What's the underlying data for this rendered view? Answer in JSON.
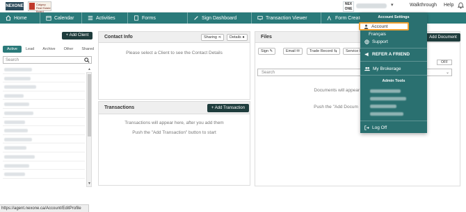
{
  "topbar": {
    "logo_left": "NEXONE",
    "logo_mid": "Calgary Real Estate Board",
    "logo_right": "NEX ONE",
    "walkthrough": "Walkthrough",
    "help": "Help"
  },
  "nav": {
    "items": [
      {
        "label": "Home",
        "icon": "home-icon"
      },
      {
        "label": "Calendar",
        "icon": "calendar-icon"
      },
      {
        "label": "Activities",
        "icon": "list-icon"
      },
      {
        "label": "Forms",
        "icon": "forms-icon"
      },
      {
        "label": "Sign Dashboard",
        "icon": "pen-icon"
      },
      {
        "label": "Transaction Viewer",
        "icon": "monitor-icon"
      },
      {
        "label": "Form Creator",
        "icon": "form-creator-icon"
      }
    ]
  },
  "clients": {
    "add_label": "+ Add Client",
    "tabs": [
      "Active",
      "Lead",
      "Archive",
      "Other",
      "Shared"
    ],
    "search_placeholder": "Search"
  },
  "contact_info": {
    "title": "Contact Info",
    "sharing_label": "Sharing",
    "details_label": "Details",
    "empty_message": "Please select a Client to see the Contact Details"
  },
  "transactions": {
    "title": "Transactions",
    "add_label": "+ Add Transaction",
    "empty_line1": "Transactions will appear here, after you add them",
    "empty_line2": "Push the \"Add Transaction\" button to start"
  },
  "files": {
    "title": "Files",
    "add_label": "Add Document",
    "sign_label": "Sign",
    "email_label": "Email",
    "trade_record_label": "Trade Record",
    "service_label": "Service R",
    "search_placeholder": "Search",
    "toggle_off": "OFF",
    "empty_line1": "Documents will appear h",
    "empty_line2": "Push the \"Add Docum"
  },
  "account_menu": {
    "account_settings": "Account Settings",
    "account": "Account",
    "francais": "Français",
    "support": "Support",
    "refer_a_friend": "REFER A FRIEND",
    "my_brokerage": "My Brokerage",
    "admin_tools": "Admin Tools",
    "log_off": "Log Off"
  },
  "statusbar": {
    "url": "https://agent.nexone.ca/Account/EditProfile"
  },
  "colors": {
    "nav_teal": "#2a7a7a",
    "dropdown_teal": "#2a7070",
    "dark_button": "#1f3d3d",
    "highlight_orange": "#f0a030"
  }
}
